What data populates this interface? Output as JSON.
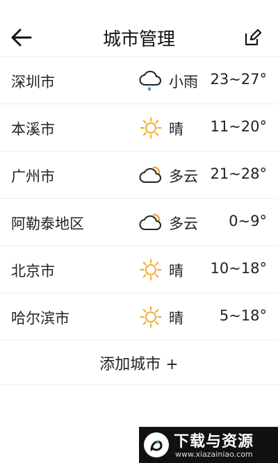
{
  "header": {
    "title": "城市管理",
    "back_icon": "arrow-left-icon",
    "edit_icon": "edit-icon"
  },
  "cities": [
    {
      "name": "深圳市",
      "weather": "小雨",
      "icon": "rain-cloud-icon",
      "temp": "23~27°"
    },
    {
      "name": "本溪市",
      "weather": "晴",
      "icon": "sun-icon",
      "temp": "11~20°"
    },
    {
      "name": "广州市",
      "weather": "多云",
      "icon": "partly-cloudy-icon",
      "temp": "21~28°"
    },
    {
      "name": "阿勒泰地区",
      "weather": "多云",
      "icon": "partly-cloudy-icon",
      "temp": "0~9°"
    },
    {
      "name": "北京市",
      "weather": "晴",
      "icon": "sun-icon",
      "temp": "10~18°"
    },
    {
      "name": "哈尔滨市",
      "weather": "晴",
      "icon": "sun-icon",
      "temp": "5~18°"
    }
  ],
  "add_city": {
    "label": "添加城市 +"
  },
  "watermark": {
    "title": "下载与资源",
    "url": "www.xiazainiao.com"
  },
  "colors": {
    "sun": "#f5a623",
    "cloud": "#222222",
    "rain_drop": "#3a8fd6"
  }
}
